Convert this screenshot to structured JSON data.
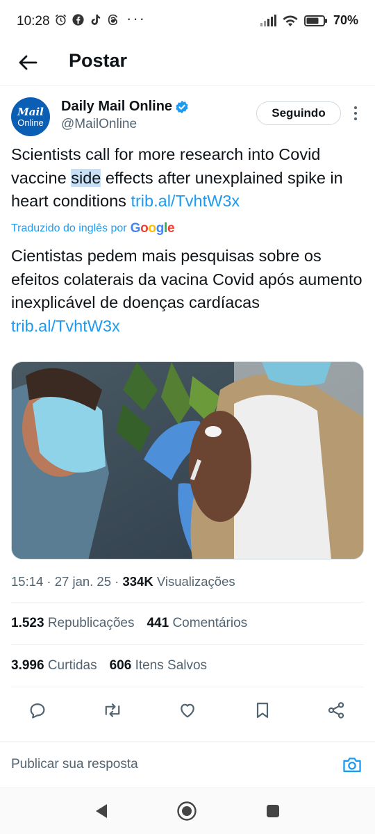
{
  "status_bar": {
    "time": "10:28",
    "notification_icons": [
      "alarm-icon",
      "facebook-icon",
      "tiktok-icon",
      "threads-icon"
    ],
    "more": "···",
    "battery": "70%"
  },
  "header": {
    "title": "Postar"
  },
  "tweet": {
    "author_name": "Daily Mail Online",
    "author_handle": "@MailOnline",
    "avatar_line1": "Mail",
    "avatar_line2": "Online",
    "follow_label": "Seguindo",
    "text_before": "Scientists call for more research into Covid vaccine ",
    "text_highlight": "side",
    "text_after": " effects after unexplained spike in heart conditions ",
    "link": "trib.al/TvhtW3x",
    "translated_label": "Traduzido do inglês por",
    "translated_provider": "Google",
    "translation_text": "Cientistas pedem mais pesquisas sobre os efeitos colaterais da vacina Covid após aumento inexplicável de doenças cardíacas ",
    "translation_link": "trib.al/TvhtW3x",
    "timestamp": "15:14 · 27 jan. 25 · ",
    "views_count": "334K",
    "views_label": " Visualizações"
  },
  "stats": {
    "reposts_count": "1.523",
    "reposts_label": "Republicações",
    "comments_count": "441",
    "comments_label": "Comentários",
    "likes_count": "3.996",
    "likes_label": "Curtidas",
    "saved_count": "606",
    "saved_label": "Itens Salvos"
  },
  "reply": {
    "placeholder": "Publicar sua resposta"
  },
  "colors": {
    "link": "#1d9bf0",
    "text": "#0f1419",
    "muted": "#536471",
    "avatar": "#0a5fb4"
  }
}
